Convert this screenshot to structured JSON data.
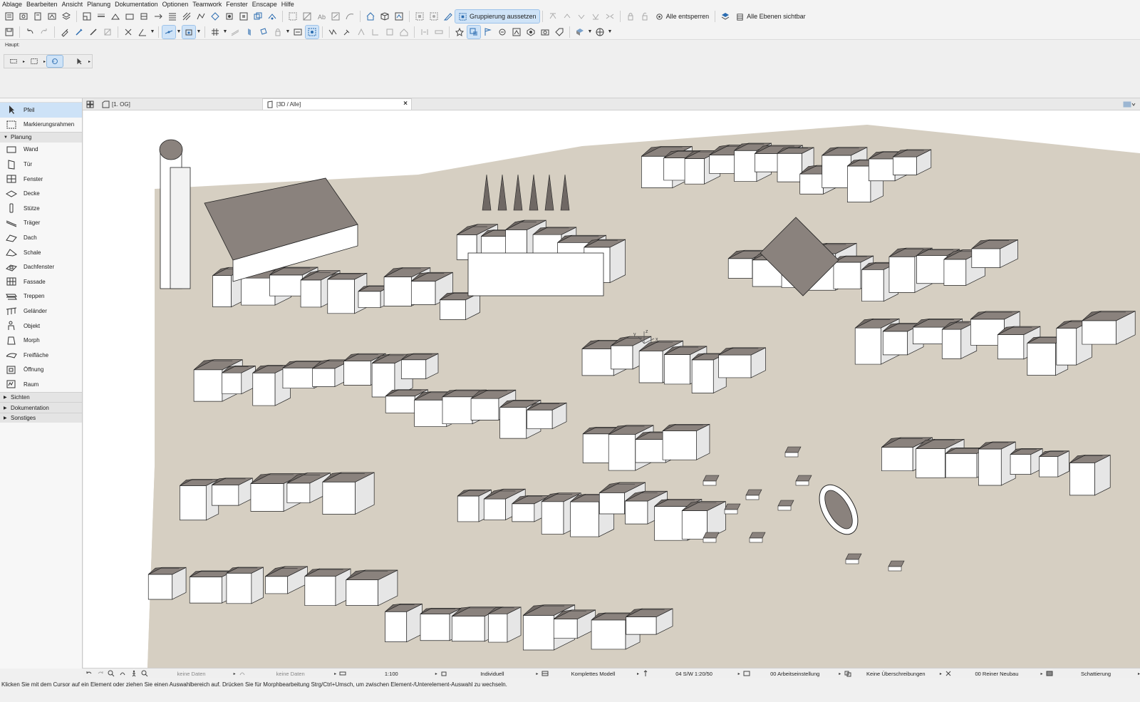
{
  "menu": [
    "Ablage",
    "Bearbeiten",
    "Ansicht",
    "Planung",
    "Dokumentation",
    "Optionen",
    "Teamwork",
    "Fenster",
    "Enscape",
    "Hilfe"
  ],
  "toolbar1": {
    "group_suspend_label": "Gruppierung aussetzen",
    "unlock_all_label": "Alle entsperren",
    "all_layers_label": "Alle Ebenen sichtbar"
  },
  "secondary": {
    "label": "Haupt:"
  },
  "toolbox": {
    "items": [
      {
        "label": "Pfeil",
        "icon": "arrow-icon",
        "selected": true
      },
      {
        "label": "Markierungsrahmen",
        "icon": "marquee-icon"
      }
    ],
    "section_planung": "Planung",
    "planung": [
      {
        "label": "Wand",
        "icon": "wall-icon"
      },
      {
        "label": "Tür",
        "icon": "door-icon"
      },
      {
        "label": "Fenster",
        "icon": "window-icon"
      },
      {
        "label": "Decke",
        "icon": "slab-icon"
      },
      {
        "label": "Stütze",
        "icon": "column-icon"
      },
      {
        "label": "Träger",
        "icon": "beam-icon"
      },
      {
        "label": "Dach",
        "icon": "roof-icon"
      },
      {
        "label": "Schale",
        "icon": "shell-icon"
      },
      {
        "label": "Dachfenster",
        "icon": "skylight-icon"
      },
      {
        "label": "Fassade",
        "icon": "curtain-wall-icon"
      },
      {
        "label": "Treppen",
        "icon": "stair-icon"
      },
      {
        "label": "Geländer",
        "icon": "railing-icon"
      },
      {
        "label": "Objekt",
        "icon": "object-icon"
      },
      {
        "label": "Morph",
        "icon": "morph-icon"
      },
      {
        "label": "Freifläche",
        "icon": "mesh-icon"
      },
      {
        "label": "Öffnung",
        "icon": "opening-icon"
      },
      {
        "label": "Raum",
        "icon": "zone-icon"
      }
    ],
    "sections_collapsed": [
      "Sichten",
      "Dokumentation",
      "Sonstiges"
    ]
  },
  "tabs": {
    "plan_tab": "[1. OG]",
    "view3d_tab": "[3D / Alle]",
    "close_symbol": "×"
  },
  "statusbar": {
    "undo_data": "keine Daten",
    "redo_data": "keine Daten",
    "scale": "1:100",
    "pen_set": "Individuell",
    "model_view": "Komplettes Modell",
    "layer_combo": "04 S/W 1:20/50",
    "work_env": "00 Arbeitseinstellung",
    "overrides": "Keine Überschreibungen",
    "renovation": "00 Reiner Neubau",
    "shading": "Schattierung"
  },
  "hint": "Klicken Sie mit dem Cursor auf ein Element oder ziehen Sie einen Auswahlbereich auf. Drücken Sie für Morphbearbeitung Strg/Ctrl+Umsch, um zwischen Element-/Unterelement-Auswahl zu wechseln.",
  "axis_labels": {
    "x": "x",
    "y": "y",
    "z": "z"
  },
  "colors": {
    "ground": "#d6cfc2",
    "roof": "#8a827d",
    "roof_dark": "#6f6864",
    "wall": "#ffffff",
    "selection": "#cde2f7"
  }
}
